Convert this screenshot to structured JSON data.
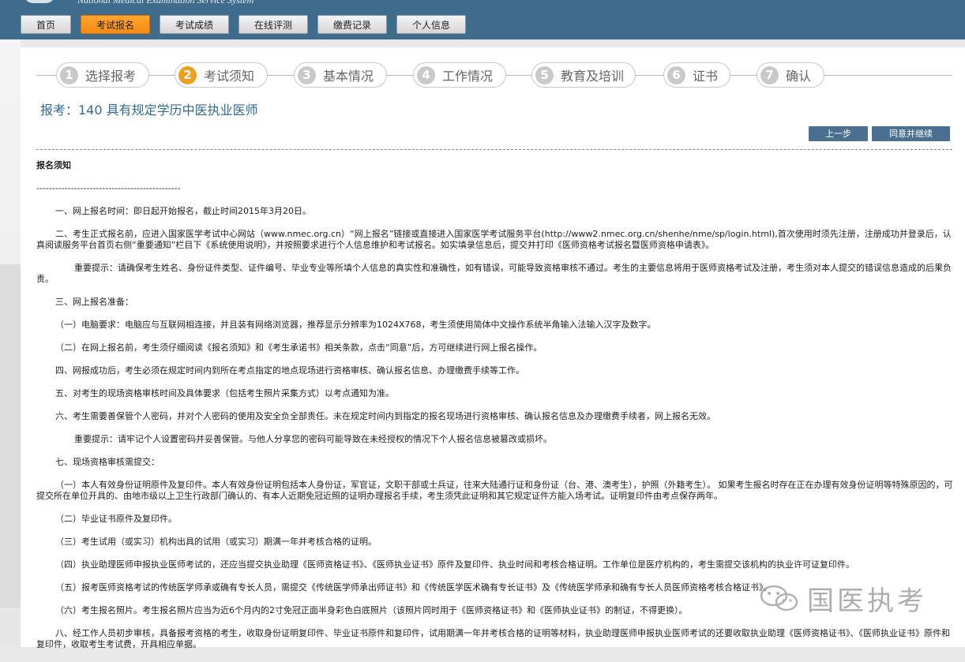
{
  "header": {
    "brand_text": "National Medical Examination Service System"
  },
  "nav": {
    "items": [
      {
        "label": "首页"
      },
      {
        "label": "考试报名"
      },
      {
        "label": "考试成绩"
      },
      {
        "label": "在线评测"
      },
      {
        "label": "缴费记录"
      },
      {
        "label": "个人信息"
      }
    ],
    "active_index": 1
  },
  "steps": [
    {
      "num": "1",
      "label": "选择报考"
    },
    {
      "num": "2",
      "label": "考试须知"
    },
    {
      "num": "3",
      "label": "基本情况"
    },
    {
      "num": "4",
      "label": "工作情况"
    },
    {
      "num": "5",
      "label": "教育及培训"
    },
    {
      "num": "6",
      "label": "证书"
    },
    {
      "num": "7",
      "label": "确认"
    }
  ],
  "current_step": 2,
  "page_title": "报考：140 具有规定学历中医执业医师",
  "actions": {
    "prev_label": "上一步",
    "agree_label": "同意并继续"
  },
  "notice": {
    "heading": "报名须知",
    "separator": "----------------------------------------------",
    "p1": "一、网上报名时间：即日起开始报名，截止时间2015年3月20日。",
    "p2": "二、考生正式报名前，应进入国家医学考试中心网站（www.nmec.org.cn）“网上报名”链接或直接进入国家医学考试服务平台(http://www2.nmec.org.cn/shenhe/nme/sp/login.html),首次使用时须先注册，注册成功并登录后，认真阅读服务平台首页右侧“重要通知”栏目下《系统使用说明》，并按照要求进行个人信息维护和考试报名。如实填录信息后，提交并打印《医师资格考试报名暨医师资格申请表》。",
    "p3": "重要提示：请确保考生姓名、身份证件类型、证件编号、毕业专业等所填个人信息的真实性和准确性，如有错误，可能导致资格审核不通过。考生的主要信息将用于医师资格考试及注册，考生须对本人提交的错误信息造成的后果负责。",
    "p4": "三、网上报名准备：",
    "p5": "（一）电脑要求：电脑应与互联网相连接，并且装有网络浏览器，推荐显示分辨率为1024X768，考生须使用简体中文操作系统半角输入法输入汉字及数字。",
    "p6": "（二）在网上报名前，考生须仔细阅读《报名须知》和《考生承诺书》相关条款，点击“同意”后，方可继续进行网上报名操作。",
    "p7": "四、网报成功后，考生必须在规定时间内到所在考点指定的地点现场进行资格审核、确认报名信息、办理缴费手续等工作。",
    "p8": "五、对考生的现场资格审核时间及具体要求（包括考生照片采集方式）以考点通知为准。",
    "p9": "六、考生需要善保管个人密码，并对个人密码的使用及安全负全部责任。未在规定时间内到指定的报名现场进行资格审核、确认报名信息及办理缴费手续者，网上报名无效。",
    "p10": "重要提示：请牢记个人设置密码并妥善保管。与他人分享您的密码可能导致在未经授权的情况下个人报名信息被篡改或损坏。",
    "p11": "七、现场资格审核需提交：",
    "p12": "（一）本人有效身份证明原件及复印件。本人有效身份证明包括本人身份证，军官证，文职干部或士兵证，往来大陆通行证和身份证（台、港、澳考生），护照（外籍考生）。 如果考生报名时存在正在办理有效身份证明等特殊原因的，可提交所在单位开具的、由地市级以上卫生行政部门确认的、有本人近期免冠近照的证明办理报名手续，考生须凭此证明和其它规定证件方能入场考试。证明复印件由考点保存两年。",
    "p13": "（二）毕业证书原件及复印件。",
    "p14": "（三）考生试用（或实习）机构出具的试用（或实习）期满一年并考核合格的证明。",
    "p15": "（四）执业助理医师申报执业医师考试的，还应当提交执业助理《医师资格证书》、《医师执业证书》原件及复印件、执业时间和考核合格证明。工作单位是医疗机构的，考生需提交该机构的执业许可证复印件。",
    "p16": "（五）报考医师资格考试的传统医学师承或确有专长人员，需提交《传统医学师承出师证书》和《传统医学医术确有专长证书》及《传统医学师承和确有专长人员医师资格考核合格证书》。",
    "p17": "（六）考生报名照片。考生报名照片应当为近6个月内的2寸免冠正面半身彩色白底照片（该照片同时用于《医师资格证书》和《医师执业证书》的制证，不得更换）。",
    "p18": "八、经工作人员初步审核，具备报考资格的考生，收取身份证明复印件、毕业证书原件和复印件，试用期满一年并考核合格的证明等材料，执业助理医师申报执业医师考试的还要收取执业助理《医师资格证书》、《医师执业证书》原件和复印件，收取考生考试费，开具相应单据。"
  },
  "watermark": {
    "text": "国医执考",
    "icon": "wechat-icon"
  },
  "colors": {
    "header_bg": "#3f6b8c",
    "nav_active": "#f58a10",
    "title": "#2e6a96",
    "action_btn": "#4a6f8f",
    "step_active": "#f0a020"
  }
}
